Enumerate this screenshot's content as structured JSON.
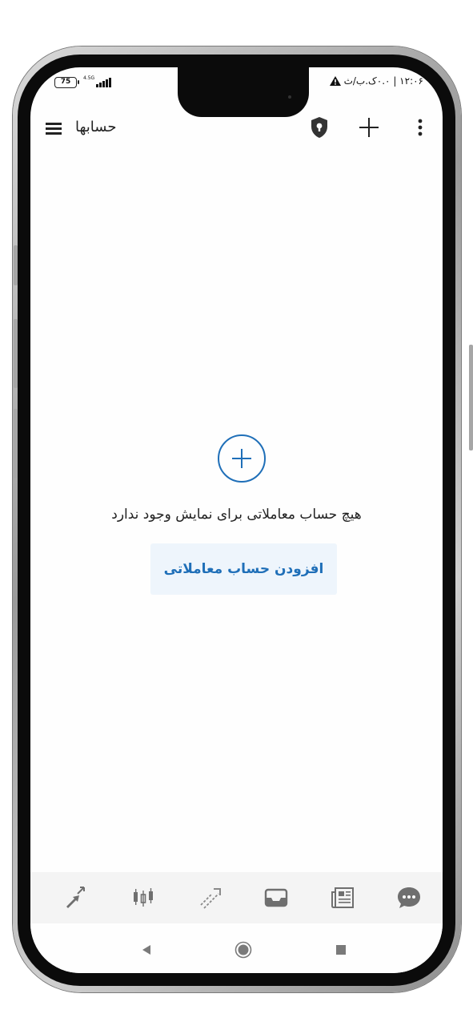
{
  "status_bar": {
    "battery": "75",
    "network": "4.5G",
    "time_carrier": "۱۲:۰۶ | ۰.۰ک.ب/ث"
  },
  "app_bar": {
    "title": "حسابها"
  },
  "empty_state": {
    "message": "هیچ حساب معاملاتی برای نمایش وجود ندارد",
    "button_label": "افزودن حساب معاملاتی"
  },
  "colors": {
    "accent": "#1f6fb8",
    "button_bg": "#eef5fc",
    "tab_icon": "#7a7a7a",
    "text": "#222222"
  },
  "bottom_tabs": [
    {
      "icon": "quotes-arrows-icon"
    },
    {
      "icon": "candlestick-chart-icon"
    },
    {
      "icon": "trade-arrows-icon"
    },
    {
      "icon": "inbox-icon"
    },
    {
      "icon": "news-icon"
    },
    {
      "icon": "chat-icon"
    }
  ]
}
